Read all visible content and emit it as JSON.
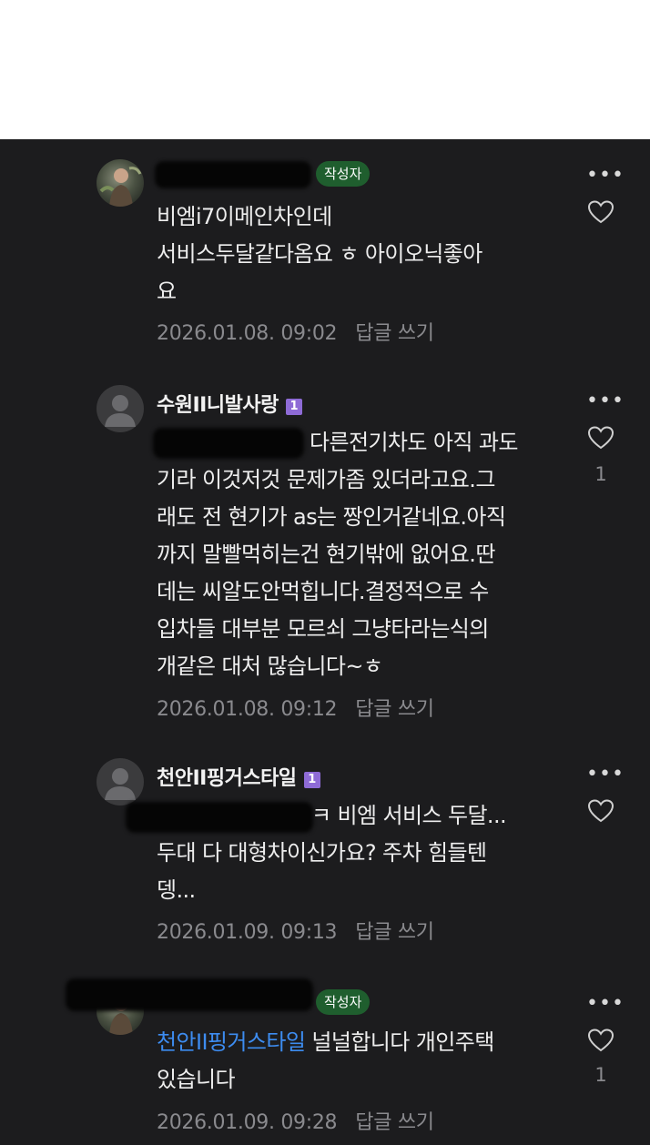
{
  "author_badge": "작성자",
  "reply_label": "답글 쓰기",
  "comments": [
    {
      "username": "",
      "is_author": true,
      "lines": [
        "비엠i7이메인차인데",
        "서비스두달같다옴요  ㅎ  아이오닉좋아",
        "요"
      ],
      "date": "2026.01.08. 09:02",
      "likes": ""
    },
    {
      "username": "수원II니발사랑",
      "level": "1",
      "is_author": false,
      "first_line": "다른전기차도 아직 과도",
      "lines": [
        "기라 이것저것 문제가좀 있더라고요.그",
        "래도 전 현기가 as는 짱인거같네요.아직",
        "까지 말빨먹히는건 현기밖에 없어요.딴",
        "데는 씨알도안먹힙니다.결정적으로 수",
        "입차들 대부분 모르쇠 그냥타라는식의",
        "개같은 대처 많습니다~ㅎ"
      ],
      "date": "2026.01.08. 09:12",
      "likes": "1"
    },
    {
      "username": "천안II핑거스타일",
      "level": "1",
      "is_author": false,
      "first_line": "ㅋ 비엠 서비스 두달...",
      "lines": [
        "두대 다 대형차이신가요? 주차 힘들텐",
        "뎅..."
      ],
      "date": "2026.01.09. 09:13",
      "likes": ""
    },
    {
      "username": "",
      "is_author": true,
      "mention": "천안II핑거스타일",
      "first_line": " 널널합니다  개인주택",
      "lines": [
        "있습니다"
      ],
      "date": "2026.01.09. 09:28",
      "likes": "1"
    }
  ]
}
